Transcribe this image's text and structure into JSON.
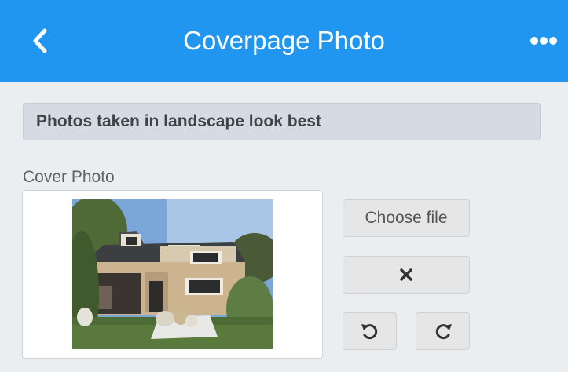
{
  "header": {
    "title": "Coverpage Photo",
    "back_icon": "chevron-left-icon",
    "menu_icon": "more-horizontal-icon",
    "background_color": "#2196f0"
  },
  "hint": {
    "text": "Photos taken in landscape look best"
  },
  "cover_photo": {
    "label": "Cover Photo"
  },
  "buttons": {
    "choose_file": "Choose file",
    "remove_icon": "close-icon",
    "rotate_left_icon": "rotate-left-icon",
    "rotate_right_icon": "rotate-right-icon"
  }
}
